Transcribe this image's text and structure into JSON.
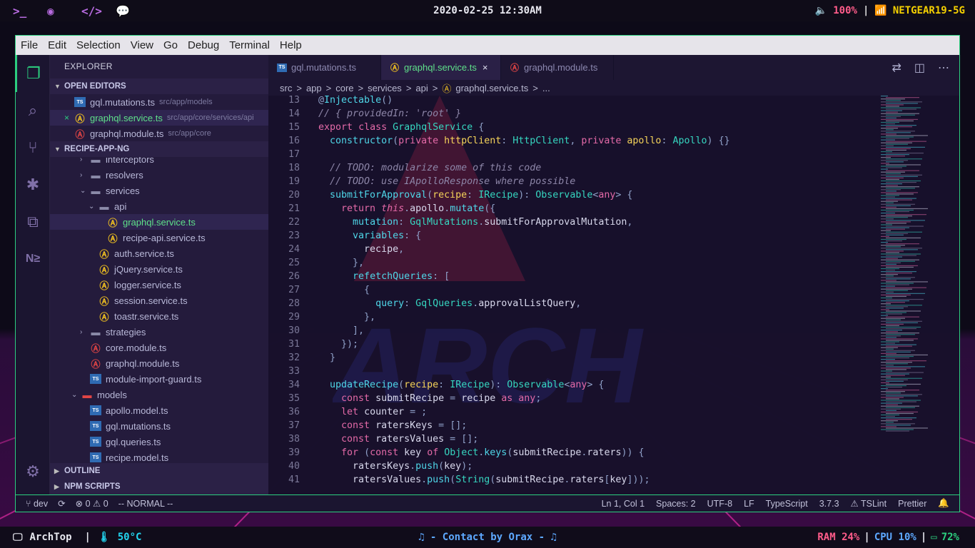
{
  "topbar": {
    "terminal_icon": ">_",
    "clock": "2020-02-25 12:30AM",
    "volume": "100%",
    "separator": "|",
    "wifi": "NETGEAR19-5G"
  },
  "menu": [
    "File",
    "Edit",
    "Selection",
    "View",
    "Go",
    "Debug",
    "Terminal",
    "Help"
  ],
  "sidebar": {
    "title": "EXPLORER",
    "open_editors_label": "OPEN EDITORS",
    "open_editors": [
      {
        "icon": "TS",
        "type": "ts",
        "name": "gql.mutations.ts",
        "path": "src/app/models"
      },
      {
        "icon": "A",
        "type": "ngy",
        "name": "graphql.service.ts",
        "path": "src/app/core/services/api",
        "active": true
      },
      {
        "icon": "A",
        "type": "ng",
        "name": "graphql.module.ts",
        "path": "src/app/core"
      }
    ],
    "project_label": "RECIPE-APP-NG",
    "tree": [
      {
        "indent": 1,
        "chev": ">",
        "icon": "folder",
        "name": "interceptors"
      },
      {
        "indent": 1,
        "chev": ">",
        "icon": "folder",
        "name": "resolvers"
      },
      {
        "indent": 1,
        "chev": "v",
        "icon": "folder",
        "name": "services"
      },
      {
        "indent": 2,
        "chev": "v",
        "icon": "folder",
        "name": "api"
      },
      {
        "indent": 3,
        "chev": "",
        "icon": "ngy",
        "name": "graphql.service.ts",
        "sel": true
      },
      {
        "indent": 3,
        "chev": "",
        "icon": "ngy",
        "name": "recipe-api.service.ts"
      },
      {
        "indent": 2,
        "chev": "",
        "icon": "ngy",
        "name": "auth.service.ts"
      },
      {
        "indent": 2,
        "chev": "",
        "icon": "ngy",
        "name": "jQuery.service.ts"
      },
      {
        "indent": 2,
        "chev": "",
        "icon": "ngy",
        "name": "logger.service.ts"
      },
      {
        "indent": 2,
        "chev": "",
        "icon": "ngy",
        "name": "session.service.ts"
      },
      {
        "indent": 2,
        "chev": "",
        "icon": "ngy",
        "name": "toastr.service.ts"
      },
      {
        "indent": 1,
        "chev": ">",
        "icon": "folder",
        "name": "strategies"
      },
      {
        "indent": 1,
        "chev": "",
        "icon": "ng",
        "name": "core.module.ts"
      },
      {
        "indent": 1,
        "chev": "",
        "icon": "ng",
        "name": "graphql.module.ts"
      },
      {
        "indent": 1,
        "chev": "",
        "icon": "ts",
        "name": "module-import-guard.ts"
      },
      {
        "indent": 0,
        "chev": "v",
        "icon": "folder-red",
        "name": "models"
      },
      {
        "indent": 1,
        "chev": "",
        "icon": "ts",
        "name": "apollo.model.ts"
      },
      {
        "indent": 1,
        "chev": "",
        "icon": "ts",
        "name": "gql.mutations.ts"
      },
      {
        "indent": 1,
        "chev": "",
        "icon": "ts",
        "name": "gql.queries.ts"
      },
      {
        "indent": 1,
        "chev": "",
        "icon": "ts",
        "name": "recipe.model.ts"
      }
    ],
    "outline_label": "OUTLINE",
    "npm_label": "NPM SCRIPTS"
  },
  "tabs": [
    {
      "icon": "TS",
      "type": "ts",
      "label": "gql.mutations.ts"
    },
    {
      "icon": "A",
      "type": "ngy",
      "label": "graphql.service.ts",
      "active": true,
      "close": "×"
    },
    {
      "icon": "A",
      "type": "ng",
      "label": "graphql.module.ts"
    }
  ],
  "breadcrumbs": [
    "src",
    ">",
    "app",
    ">",
    "core",
    ">",
    "services",
    ">",
    "api",
    ">",
    "graphql.service.ts",
    ">",
    "..."
  ],
  "code": [
    {
      "n": "13",
      "t": "@Injectable()"
    },
    {
      "n": "14",
      "t": "// { providedIn: 'root' }"
    },
    {
      "n": "15",
      "t": "export class GraphqlService {"
    },
    {
      "n": "16",
      "t": "  constructor(private httpClient: HttpClient, private apollo: Apollo) {}"
    },
    {
      "n": "17",
      "t": ""
    },
    {
      "n": "18",
      "t": "  // TODO: modularize some of this code"
    },
    {
      "n": "19",
      "t": "  // TODO: use IApolloResponse where possible"
    },
    {
      "n": "20",
      "t": "  submitForApproval(recipe: IRecipe): Observable<any> {"
    },
    {
      "n": "21",
      "t": "    return this.apollo.mutate({"
    },
    {
      "n": "22",
      "t": "      mutation: GqlMutations.submitForApprovalMutation,"
    },
    {
      "n": "23",
      "t": "      variables: {"
    },
    {
      "n": "24",
      "t": "        recipe,"
    },
    {
      "n": "25",
      "t": "      },"
    },
    {
      "n": "26",
      "t": "      refetchQueries: ["
    },
    {
      "n": "27",
      "t": "        {"
    },
    {
      "n": "28",
      "t": "          query: GqlQueries.approvalListQuery,"
    },
    {
      "n": "29",
      "t": "        },"
    },
    {
      "n": "30",
      "t": "      ],"
    },
    {
      "n": "31",
      "t": "    });"
    },
    {
      "n": "32",
      "t": "  }"
    },
    {
      "n": "33",
      "t": ""
    },
    {
      "n": "34",
      "t": "  updateRecipe(recipe: IRecipe): Observable<any> {"
    },
    {
      "n": "35",
      "t": "    const submitRecipe = recipe as any;"
    },
    {
      "n": "36",
      "t": "    let counter = 0;"
    },
    {
      "n": "37",
      "t": "    const ratersKeys = [];"
    },
    {
      "n": "38",
      "t": "    const ratersValues = [];"
    },
    {
      "n": "39",
      "t": "    for (const key of Object.keys(submitRecipe.raters)) {"
    },
    {
      "n": "40",
      "t": "      ratersKeys.push(key);"
    },
    {
      "n": "41",
      "t": "      ratersValues.push(String(submitRecipe.raters[key]));"
    }
  ],
  "watermark": "ARCH",
  "statusbar": {
    "branch": "dev",
    "errors": "0",
    "warnings": "0",
    "mode": "-- NORMAL --",
    "position": "Ln 1, Col 1",
    "spaces": "Spaces: 2",
    "encoding": "UTF-8",
    "eol": "LF",
    "language": "TypeScript",
    "version": "3.7.3",
    "tslint": "TSLint",
    "prettier": "Prettier"
  },
  "bottombar": {
    "host": "ArchTop",
    "sep": "|",
    "temp": "50°C",
    "music": "♫ - Contact by Orax - ♫",
    "ram": "RAM 24%",
    "cpu": "CPU 10%",
    "battery": "72%"
  },
  "colors": {
    "accent": "#2ccf7f",
    "keyword": "#e46aa8",
    "type": "#36d6c0",
    "string": "#f0a560",
    "comment": "#8d86a8",
    "func": "#4fd6e8",
    "param": "#f5d35a"
  }
}
